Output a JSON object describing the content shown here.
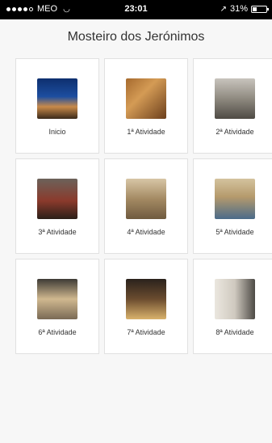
{
  "status_bar": {
    "carrier": "MEO",
    "time": "23:01",
    "battery_percent": "31%",
    "battery_level": 0.31,
    "signal_icon": "signal-dots-icon",
    "wifi_icon": "wifi-icon",
    "location_icon": "location-arrow-icon",
    "battery_icon": "battery-icon"
  },
  "header": {
    "title": "Mosteiro dos Jerónimos"
  },
  "tiles": [
    {
      "label": "Inicio"
    },
    {
      "label": "1ª Atividade"
    },
    {
      "label": "2ª Atividade"
    },
    {
      "label": "3ª Atividade"
    },
    {
      "label": "4ª Atividade"
    },
    {
      "label": "5ª Atividade"
    },
    {
      "label": "6ª Atividade"
    },
    {
      "label": "7ª Atividade"
    },
    {
      "label": "8ª Atividade"
    }
  ]
}
